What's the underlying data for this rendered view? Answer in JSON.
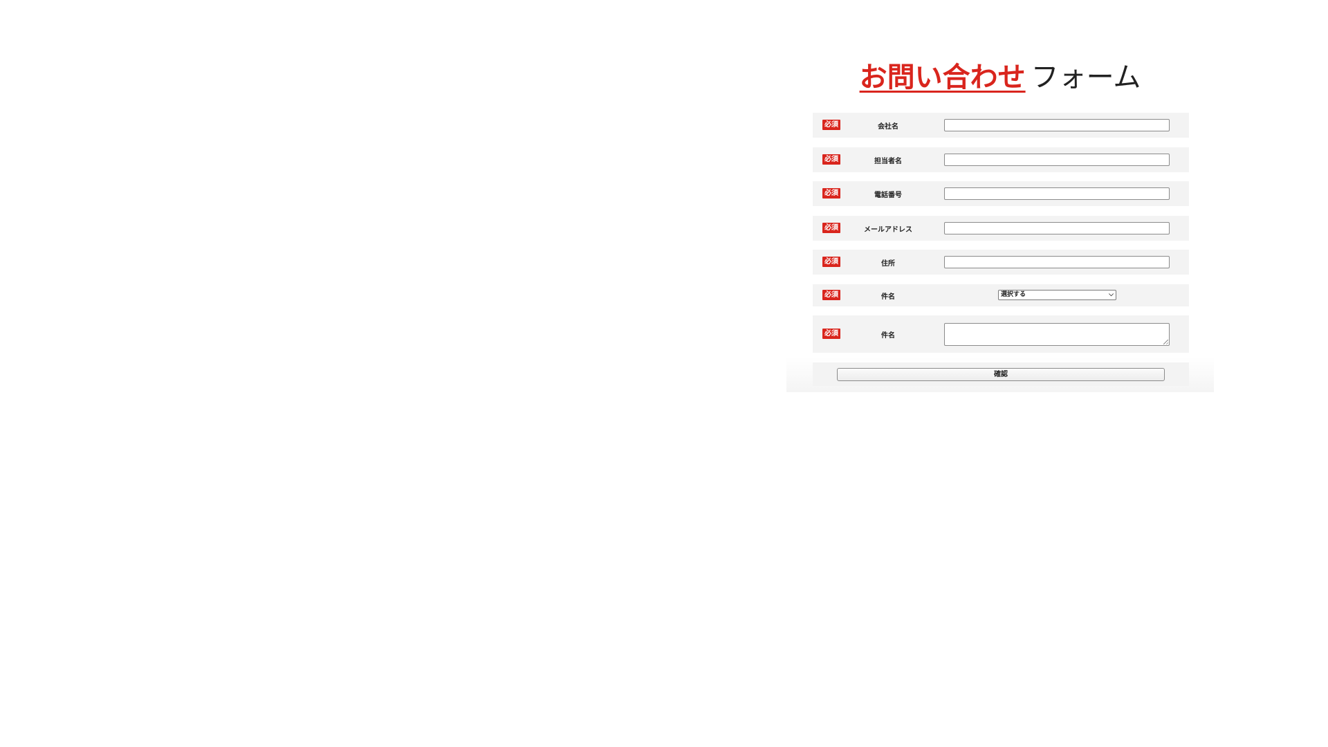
{
  "title": {
    "highlight": "お問い合わせ",
    "rest": "フォーム"
  },
  "colors": {
    "accent": "#d9251d",
    "row_background": "#f3f3f3"
  },
  "form": {
    "fields": [
      {
        "required_badge": "必須",
        "label": "会社名",
        "type": "text",
        "value": ""
      },
      {
        "required_badge": "必須",
        "label": "担当者名",
        "type": "text",
        "value": ""
      },
      {
        "required_badge": "必須",
        "label": "電話番号",
        "type": "text",
        "value": ""
      },
      {
        "required_badge": "必須",
        "label": "メールアドレス",
        "type": "text",
        "value": ""
      },
      {
        "required_badge": "必須",
        "label": "住所",
        "type": "text",
        "value": ""
      },
      {
        "required_badge": "必須",
        "label": "件名",
        "type": "select",
        "selected": "選択する"
      },
      {
        "required_badge": "必須",
        "label": "件名",
        "type": "textarea",
        "value": ""
      }
    ],
    "submit_label": "確認"
  }
}
